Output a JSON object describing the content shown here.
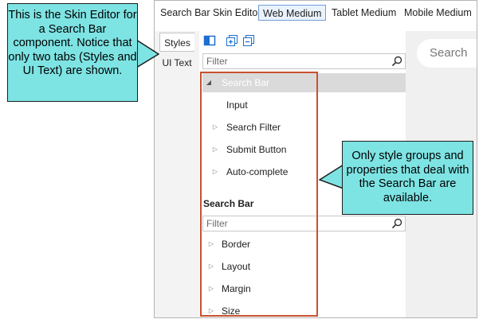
{
  "editor": {
    "top_tabs": [
      {
        "label": "Search Bar Skin Editor"
      },
      {
        "label": "Web Medium"
      },
      {
        "label": "Tablet Medium"
      },
      {
        "label": "Mobile Medium"
      }
    ],
    "side_tabs": [
      {
        "label": "Styles"
      },
      {
        "label": "UI Text"
      }
    ],
    "filter_placeholder": "Filter",
    "tree": {
      "root": "Search Bar",
      "children": [
        "Input",
        "Search Filter",
        "Submit Button",
        "Auto-complete"
      ]
    },
    "group_title": "Search Bar",
    "property_filter_placeholder": "Filter",
    "properties": [
      "Border",
      "Layout",
      "Margin",
      "Size"
    ],
    "preview_placeholder": "Search"
  },
  "callouts": {
    "left": "This is the Skin Editor for a Search Bar component. Notice that only two tabs (Styles and UI Text) are shown.",
    "right": "Only style groups and properties that deal with the Search Bar are available."
  },
  "colors": {
    "callout_fill": "#7ee3e3",
    "highlight_border": "#c9512e",
    "active_tab_border": "#6f9fd8"
  },
  "icons": [
    "panel-toggle-icon",
    "expand-all-icon",
    "collapse-all-icon",
    "magnifier-icon",
    "expanded-arrow-icon",
    "collapsed-arrow-icon"
  ]
}
